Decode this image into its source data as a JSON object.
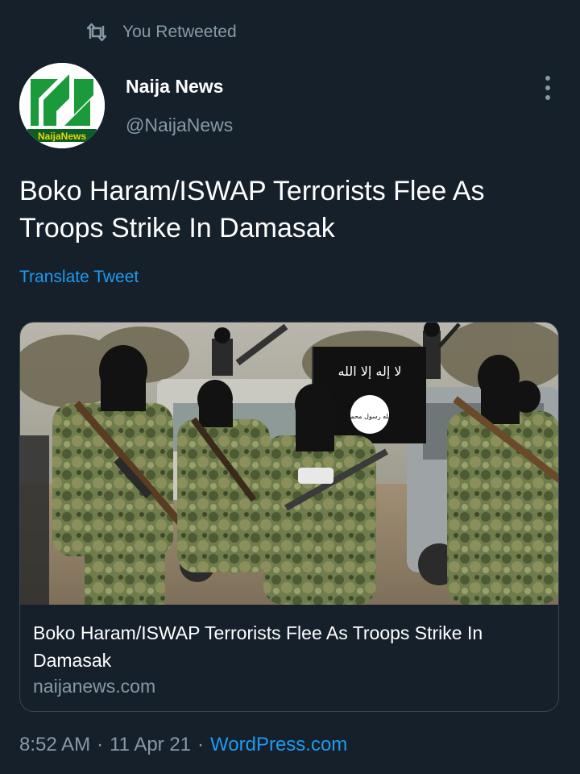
{
  "retweet": {
    "icon": "retweet-icon",
    "label": "You Retweeted"
  },
  "author": {
    "name": "Naija News",
    "handle": "@NaijaNews",
    "avatar_text": "NaijaNews",
    "avatar_colors": {
      "green": "#1a9a3a",
      "dark": "#0b5e25",
      "yellow": "#f2d20c"
    }
  },
  "more_icon": "more-vertical-icon",
  "tweet": {
    "text": "Boko Haram/ISWAP Terrorists Flee As Troops Strike In Damasak",
    "translate_label": "Translate Tweet"
  },
  "card": {
    "image_flag_text": "لا إله إلا الله",
    "image_seal_text": "الله رسول محمد",
    "title": "Boko Haram/ISWAP Terrorists Flee As Troops Strike In Damasak",
    "domain": "naijanews.com"
  },
  "meta": {
    "time": "8:52 AM",
    "separator": "·",
    "date": "11 Apr 21",
    "source": "WordPress.com"
  },
  "colors": {
    "background": "#15202b",
    "secondary_text": "#8899a6",
    "link": "#1d9bf0",
    "border": "#38444d"
  }
}
